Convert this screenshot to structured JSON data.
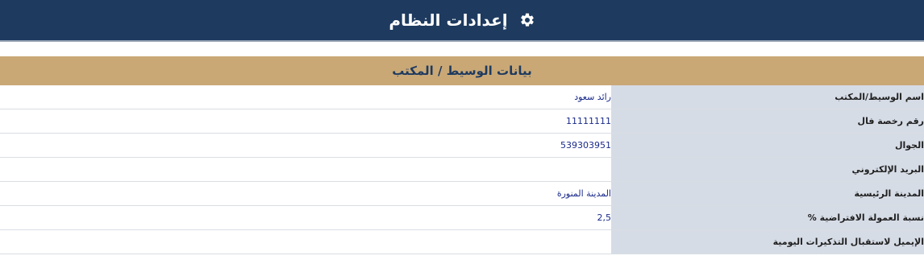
{
  "header": {
    "title": "إعدادات النظام",
    "icon": "gear-icon"
  },
  "section": {
    "title": "بيانات الوسيط / المكتب"
  },
  "rows": [
    {
      "label": "اسم الوسيط/المكتب",
      "value": "رائد سعود"
    },
    {
      "label": "رقم رخصة فال",
      "value": "11111111"
    },
    {
      "label": "الجوال",
      "value": "539303951"
    },
    {
      "label": "البريد الإلكتروني",
      "value": ""
    },
    {
      "label": "المدينة الرئيسية",
      "value": "المدينة المنورة"
    },
    {
      "label": "نسبة العمولة الافتراضية %",
      "value": "2,5"
    },
    {
      "label": "الإيميل لاستقبال التذكيرات اليومية",
      "value": ""
    }
  ],
  "colors": {
    "header_bg": "#1e3a5f",
    "section_bg": "#c9a876",
    "label_bg": "#d6dce6",
    "value_text": "#1a2a8a"
  }
}
